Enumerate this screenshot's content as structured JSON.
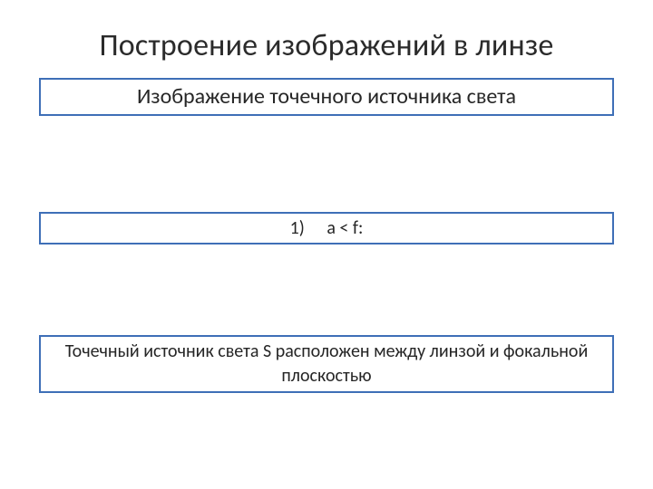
{
  "title": "Построение изображений в линзе",
  "subtitle": "Изображение точечного источника света",
  "condition": "1)  a < f:",
  "description": "Точечный источник света S расположен между линзой и фокальной плоскостью"
}
